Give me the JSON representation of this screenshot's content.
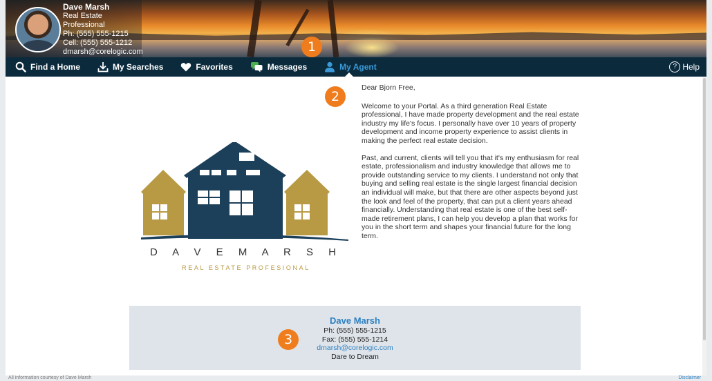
{
  "agent": {
    "name": "Dave Marsh",
    "title": "Real Estate Professional",
    "phone": "Ph: (555) 555-1215",
    "cell": "Cell: (555) 555-1212",
    "email": "dmarsh@corelogic.com"
  },
  "nav": {
    "items": [
      {
        "label": "Find a Home",
        "icon": "search-icon"
      },
      {
        "label": "My Searches",
        "icon": "download-icon"
      },
      {
        "label": "Favorites",
        "icon": "heart-icon"
      },
      {
        "label": "Messages",
        "icon": "messages-icon"
      },
      {
        "label": "My Agent",
        "icon": "person-icon",
        "active": true
      }
    ],
    "help_label": "Help"
  },
  "logo": {
    "name_text": "D A V E   M A R S H",
    "tagline": "REAL ESTATE PROFESIONAL",
    "colors": {
      "navy": "#1c3f5a",
      "gold": "#b99a44"
    }
  },
  "letter": {
    "greeting": "Dear Bjorn Free,",
    "paragraph1": "Welcome to your Portal. As a third generation Real Estate professional, I have made property development and the real estate industry my life's focus. I personally have over 10 years of property development and income property experience to assist clients in making the perfect real estate decision.",
    "paragraph2": "Past, and current, clients will tell you that it's my enthusiasm for real estate, professionalism and industry knowledge that allows me to provide outstanding service to my clients. I understand not only that buying and selling real estate is the single largest financial decision an individual will make, but that there are other aspects beyond just the look and feel of the property, that can put a client years ahead financially. Understanding that real estate is one of the best self-made retirement plans, I can help you develop a plan that works for you in the short term and shapes your financial future for the long term."
  },
  "contact_card": {
    "name": "Dave Marsh",
    "phone": "Ph: (555) 555-1215",
    "fax": "Fax: (555) 555-1214",
    "email": "dmarsh@corelogic.com",
    "slogan": "Dare to Dream"
  },
  "callouts": [
    "1",
    "2",
    "3"
  ],
  "footer": {
    "left": "All information courtesy of Dave Marsh",
    "right": "Disclaimer"
  },
  "colors": {
    "nav_bg": "#0b2b3d",
    "accent_blue": "#3a9ad9",
    "callout_orange": "#ef7d1d",
    "card_bg": "#dfe4ea"
  }
}
